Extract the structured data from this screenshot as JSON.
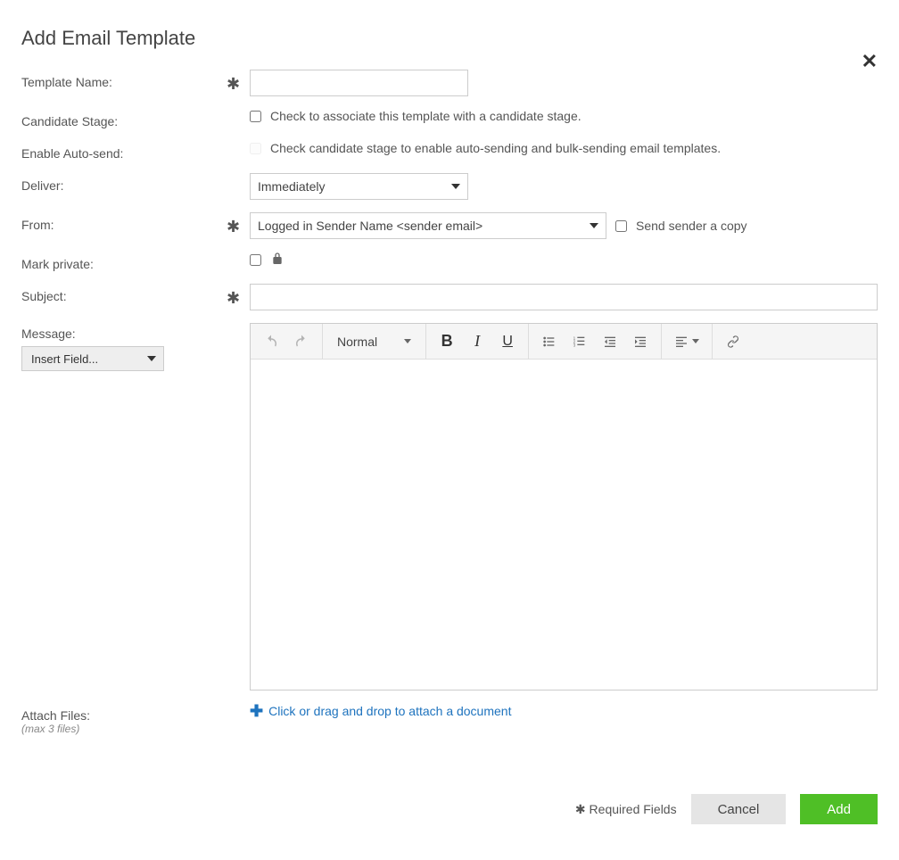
{
  "modal": {
    "title": "Add Email Template",
    "close_label": "Close"
  },
  "labels": {
    "template_name": "Template Name:",
    "candidate_stage": "Candidate Stage:",
    "enable_auto_send": "Enable Auto-send:",
    "deliver": "Deliver:",
    "from": "From:",
    "mark_private": "Mark private:",
    "subject": "Subject:",
    "message": "Message:",
    "attach_files": "Attach Files:",
    "max_files": "(max 3 files)"
  },
  "fields": {
    "template_name_value": "",
    "candidate_stage_text": "Check to associate this template with a candidate stage.",
    "auto_send_text": "Check candidate stage to enable auto-sending and bulk-sending email templates.",
    "deliver_value": "Immediately",
    "from_value": "Logged in Sender Name <sender email>",
    "send_copy_label": "Send sender a copy",
    "subject_value": "",
    "insert_field_label": "Insert Field...",
    "format_label": "Normal",
    "attach_text": "Click or drag and drop to attach a document"
  },
  "footer": {
    "required_note": "✱ Required Fields",
    "cancel": "Cancel",
    "add": "Add"
  },
  "asterisk": "✱"
}
